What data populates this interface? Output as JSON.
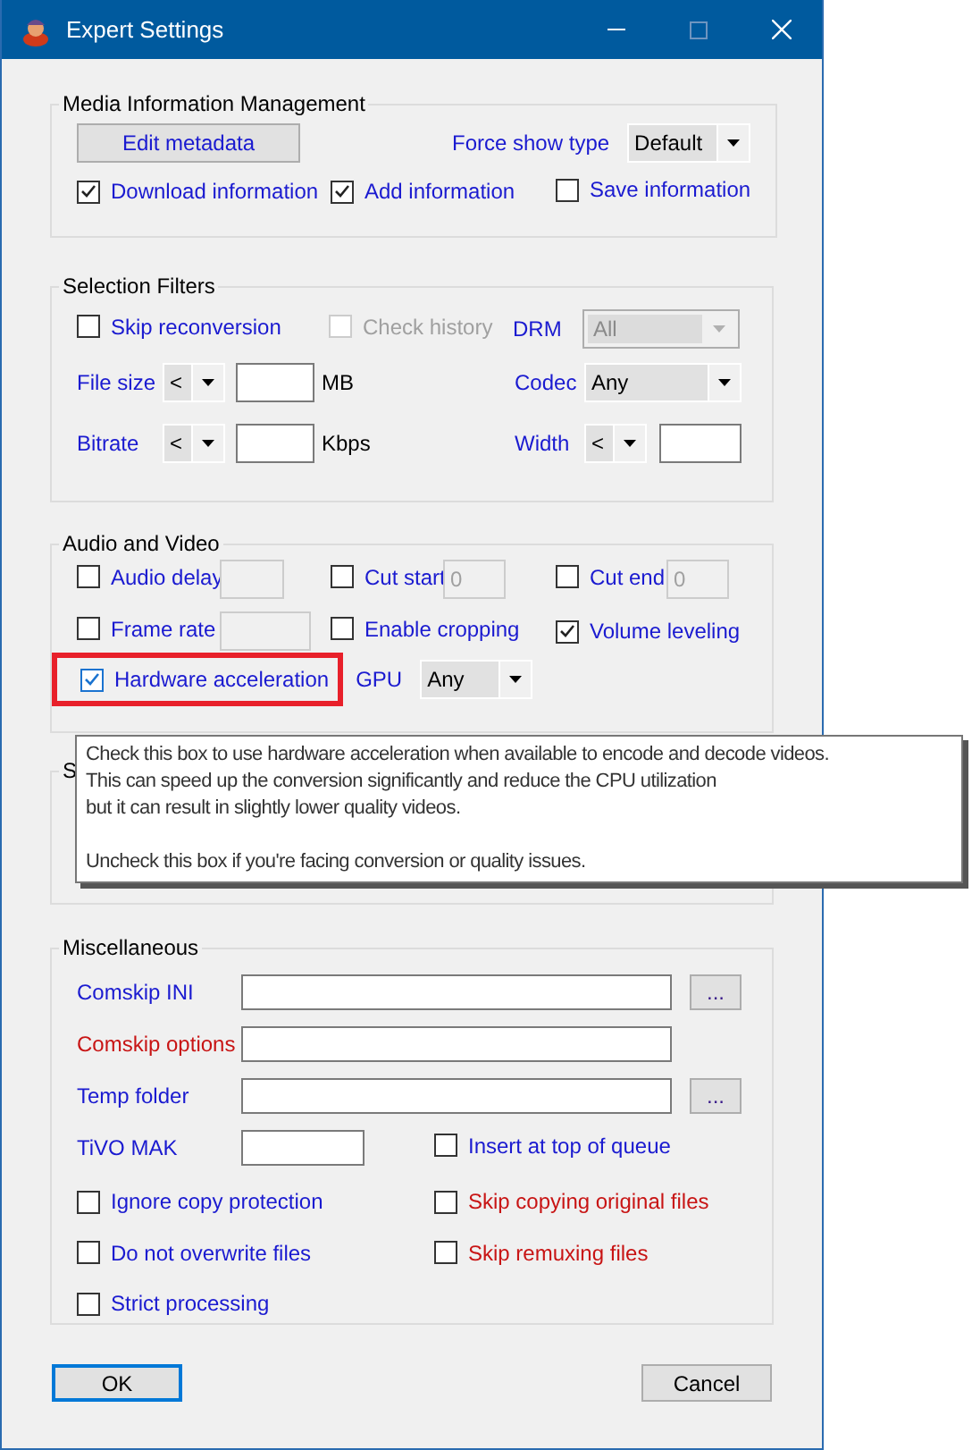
{
  "window": {
    "title": "Expert Settings"
  },
  "media_info": {
    "title": "Media Information Management",
    "edit_button": "Edit metadata",
    "force_show_type": {
      "label": "Force show type",
      "value": "Default"
    },
    "checkboxes": [
      {
        "label": "Download information",
        "checked": true
      },
      {
        "label": "Add information",
        "checked": true
      },
      {
        "label": "Save information",
        "checked": false
      }
    ]
  },
  "selection_filters": {
    "title": "Selection Filters",
    "skip_reconversion": {
      "label": "Skip reconversion",
      "checked": false
    },
    "check_history": {
      "label": "Check history",
      "checked": false,
      "disabled": true
    },
    "drm": {
      "label": "DRM",
      "value": "All",
      "disabled": true
    },
    "file_size": {
      "label": "File size",
      "operator": "<",
      "unit": "MB"
    },
    "codec": {
      "label": "Codec",
      "value": "Any"
    },
    "bitrate": {
      "label": "Bitrate",
      "operator": "<",
      "unit": "Kbps"
    },
    "width": {
      "label": "Width",
      "operator": "<"
    }
  },
  "audio_video": {
    "title": "Audio and Video",
    "audio_delay": {
      "label": "Audio delay",
      "checked": false
    },
    "cut_start": {
      "label": "Cut start",
      "checked": false,
      "value": "0"
    },
    "cut_end": {
      "label": "Cut end",
      "checked": false,
      "value": "0"
    },
    "frame_rate": {
      "label": "Frame rate",
      "checked": false
    },
    "enable_cropping": {
      "label": "Enable cropping",
      "checked": false
    },
    "volume_leveling": {
      "label": "Volume leveling",
      "checked": true
    },
    "hardware_acceleration": {
      "label": "Hardware acceleration",
      "checked": true,
      "highlighted": true
    },
    "gpu": {
      "label": "GPU",
      "value": "Any"
    }
  },
  "group_4": {
    "title": "S"
  },
  "tooltip": {
    "paragraphs": [
      "Check this box to use hardware acceleration when available to encode and decode videos.\nThis can speed up the conversion significantly and reduce the CPU utilization\nbut it can result in slightly lower quality videos.",
      "Uncheck this box if you're facing conversion or quality issues."
    ]
  },
  "miscellaneous": {
    "title": "Miscellaneous",
    "paths": [
      {
        "label": "Comskip INI",
        "color": "#1a1ad0",
        "browse": "..."
      },
      {
        "label": "Comskip options",
        "color": "#c81414"
      },
      {
        "label": "Temp folder",
        "color": "#1a1ad0",
        "browse": "..."
      }
    ],
    "tivo_mak": {
      "label": "TiVO MAK",
      "color": "#1a1ad0"
    },
    "insert_at_top": {
      "label": "Insert at top of queue",
      "checked": false,
      "color": "#1a1ad0"
    },
    "checkboxes": [
      {
        "label": "Ignore copy protection",
        "checked": false,
        "color": "#1a1ad0"
      },
      {
        "label": "Skip copying original files",
        "checked": false,
        "color": "#c81414"
      },
      {
        "label": "Do not overwrite files",
        "checked": false,
        "color": "#1a1ad0"
      },
      {
        "label": "Skip remuxing files",
        "checked": false,
        "color": "#c81414"
      },
      {
        "label": "Strict processing",
        "checked": false,
        "color": "#1a1ad0"
      }
    ]
  },
  "buttons": {
    "ok": {
      "label": "OK",
      "default": true
    },
    "cancel": {
      "label": "Cancel",
      "default": false
    }
  }
}
